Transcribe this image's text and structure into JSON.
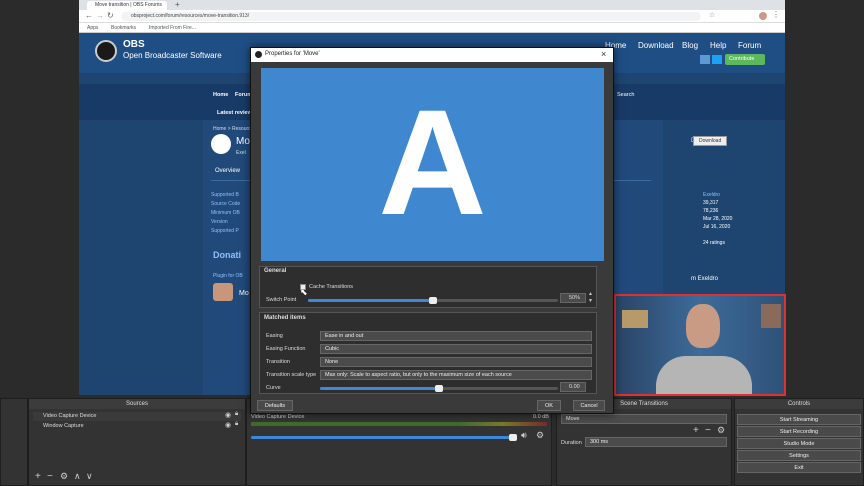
{
  "browser": {
    "tab_title": "Move transition | OBS Forums",
    "url": "obsproject.com/forum/resources/move-transition.913/",
    "bookmarks": [
      "Apps",
      "Bookmarks",
      "Imported From Fire..."
    ]
  },
  "site": {
    "logo_title": "OBS",
    "logo_subtitle": "Open Broadcaster Software",
    "nav": [
      "Home",
      "Download",
      "Blog",
      "Help",
      "Forum"
    ],
    "contribute": "Contribute",
    "subnav": [
      "Home",
      "Forums"
    ],
    "search": "Search",
    "latest_reviews": "Latest reviews",
    "breadcrumb": "Home > Resources",
    "page_title_partial": "Mo",
    "author_partial": "Exel",
    "overview_tab": "Overview",
    "download_button": "Download",
    "info_labels": [
      "Supported B",
      "Source Code",
      "Minimum OB",
      "Version",
      "Supported P"
    ],
    "info_values": [
      "Exeldro",
      "39,317",
      "78,236",
      "Mar 28, 2020",
      "Jul 16, 2020",
      "24 ratings"
    ],
    "donations_partial": "Donati",
    "plugin_for": "Plugin for OB",
    "more_partial": "Mo",
    "author_right": "m Exeldro"
  },
  "dialog": {
    "title": "Properties for 'Move'",
    "preview_letter": "A",
    "general": {
      "header": "General",
      "cache_label": "Cache Transitions",
      "cache_checked": false,
      "switch_point_label": "Switch Point",
      "switch_point_value": "50%",
      "switch_point_fraction": 0.5
    },
    "matched": {
      "header": "Matched items",
      "rows": [
        {
          "label": "Easing",
          "value": "Ease in and out"
        },
        {
          "label": "Easing Function",
          "value": "Cubic"
        },
        {
          "label": "Transition",
          "value": "None"
        },
        {
          "label": "Transition scale type",
          "value": "Max only: Scale to aspect ratio, but only to the maximum size of each source"
        }
      ],
      "curve_label": "Curve",
      "curve_value": "0.00",
      "curve_fraction": 0.5
    },
    "buttons": {
      "defaults": "Defaults",
      "ok": "OK",
      "cancel": "Cancel"
    }
  },
  "studio": {
    "sources_title": "Sources",
    "sources": [
      "Video Capture Device",
      "Window Capture"
    ],
    "mixer_source": "Video Capture Device",
    "mixer_db": "0.0 dB",
    "scene_transitions_title": "Scene Transitions",
    "transition_selected": "Move",
    "duration_label": "Duration",
    "duration_value": "300 ms",
    "controls_title": "Controls",
    "controls": [
      "Start Streaming",
      "Start Recording",
      "Studio Mode",
      "Settings",
      "Exit"
    ]
  },
  "colors": {
    "accent": "#3e88d8",
    "preview_bg": "#3f88d0",
    "site_header": "#1f4e84",
    "webcam_border": "#e03030"
  }
}
